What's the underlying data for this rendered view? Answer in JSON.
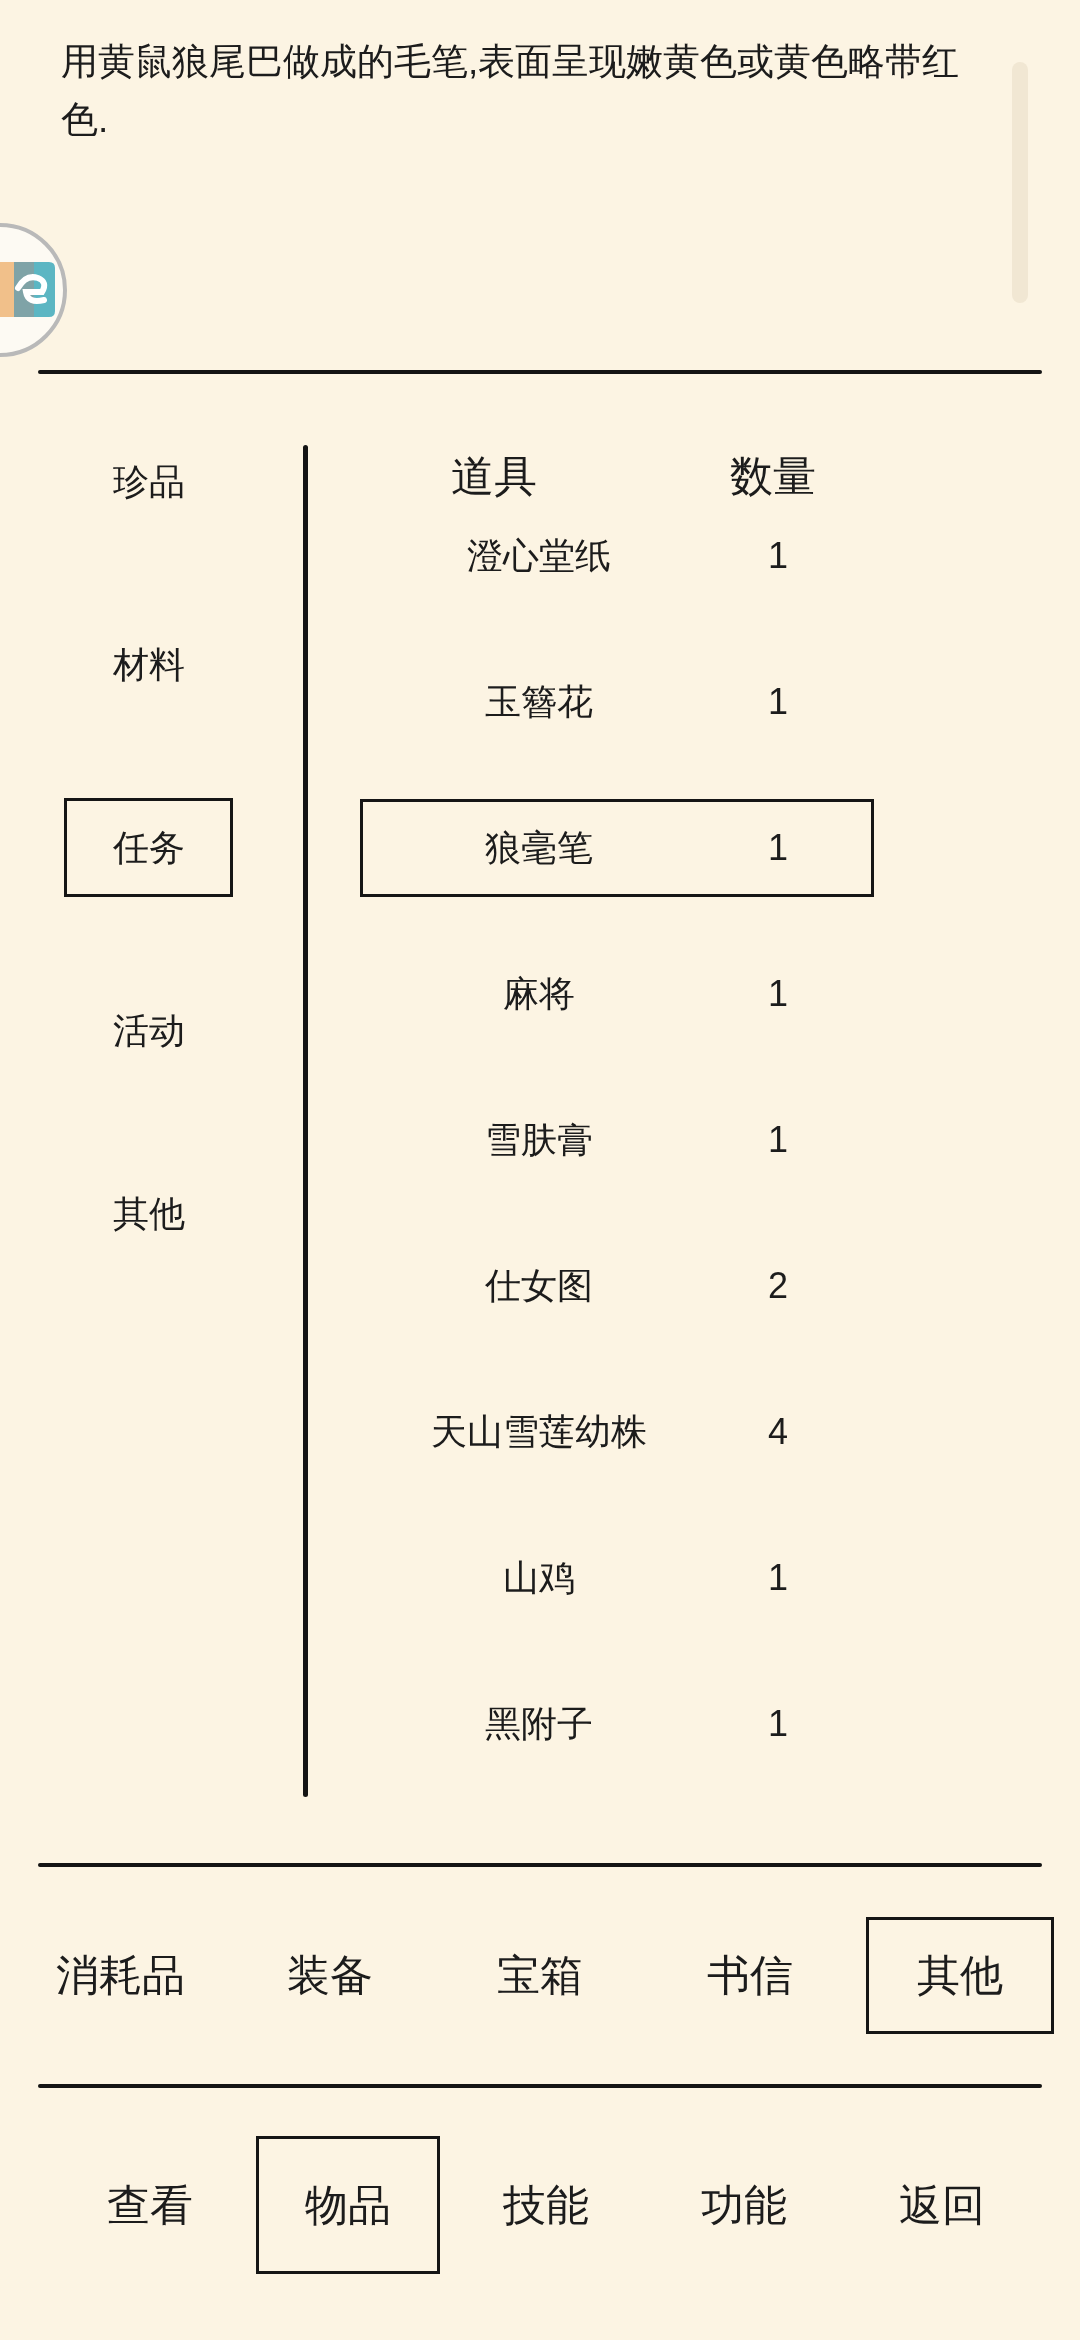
{
  "description": {
    "text": "用黄鼠狼尾巴做成的毛笔,表面呈现嫩黄色或黄色略带红色."
  },
  "categories": [
    {
      "label": "珍品",
      "selected": false
    },
    {
      "label": "材料",
      "selected": false
    },
    {
      "label": "任务",
      "selected": true
    },
    {
      "label": "活动",
      "selected": false
    },
    {
      "label": "其他",
      "selected": false
    }
  ],
  "table": {
    "columns": [
      "道具",
      "数量"
    ],
    "rows": [
      {
        "name": "澄心堂纸",
        "count": "1",
        "selected": false
      },
      {
        "name": "玉簪花",
        "count": "1",
        "selected": false
      },
      {
        "name": "狼毫笔",
        "count": "1",
        "selected": true
      },
      {
        "name": "麻将",
        "count": "1",
        "selected": false
      },
      {
        "name": "雪肤膏",
        "count": "1",
        "selected": false
      },
      {
        "name": "仕女图",
        "count": "2",
        "selected": false
      },
      {
        "name": "天山雪莲幼株",
        "count": "4",
        "selected": false
      },
      {
        "name": "山鸡",
        "count": "1",
        "selected": false
      },
      {
        "name": "黑附子",
        "count": "1",
        "selected": false
      }
    ]
  },
  "type_tabs": [
    {
      "label": "消耗品",
      "selected": false
    },
    {
      "label": "装备",
      "selected": false
    },
    {
      "label": "宝箱",
      "selected": false
    },
    {
      "label": "书信",
      "selected": false
    },
    {
      "label": "其他",
      "selected": true
    }
  ],
  "bottom_nav": [
    {
      "label": "查看",
      "selected": false
    },
    {
      "label": "物品",
      "selected": true
    },
    {
      "label": "技能",
      "selected": false
    },
    {
      "label": "功能",
      "selected": false
    },
    {
      "label": "返回",
      "selected": false
    }
  ]
}
